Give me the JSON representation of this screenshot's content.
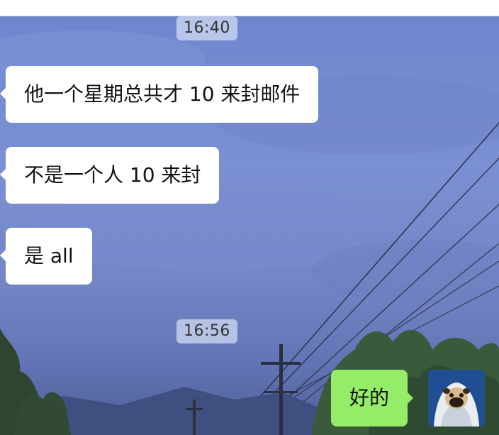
{
  "chat": {
    "timestamps": [
      "16:40",
      "16:56"
    ],
    "messages_received": [
      "他一个星期总共才 10 来封邮件",
      "不是一个人 10 来封",
      "是 all"
    ],
    "messages_sent": [
      "好的"
    ]
  },
  "colors": {
    "sent_bubble": "#95ec69",
    "received_bubble": "#ffffff",
    "timestamp_chip": "#cdd7f0"
  },
  "icons": {
    "avatar": "pug-in-blanket-avatar"
  }
}
